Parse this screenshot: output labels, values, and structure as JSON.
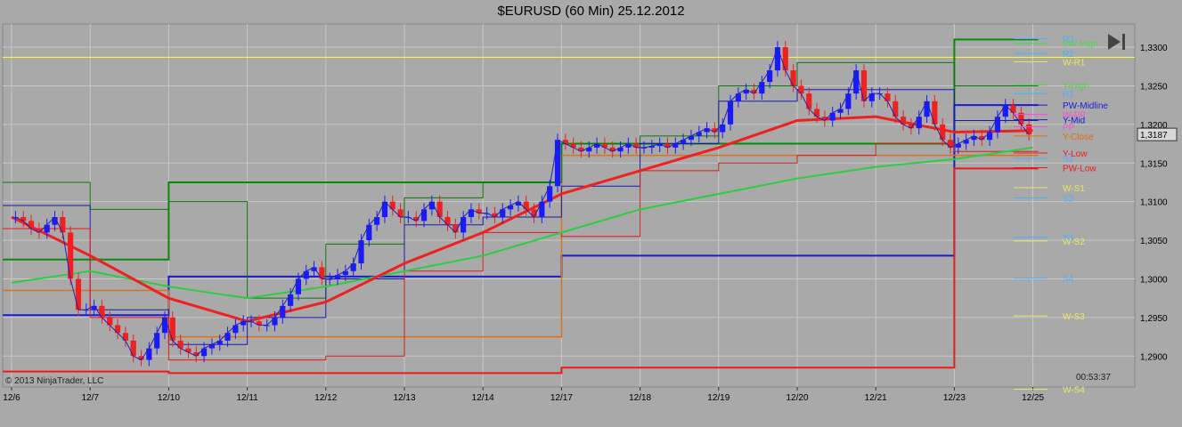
{
  "chart_data": {
    "type": "candlestick",
    "title": "$EURUSD (60 Min)  25.12.2012",
    "copyright": "© 2013 NinjaTrader, LLC",
    "timer": "00:53:37",
    "last_price": "1,3187",
    "grid": true,
    "ylim": [
      1.286,
      1.333
    ],
    "y_ticks": [
      {
        "v": 1.33,
        "label": "1,3300"
      },
      {
        "v": 1.325,
        "label": "1,3250"
      },
      {
        "v": 1.32,
        "label": "1,3200"
      },
      {
        "v": 1.315,
        "label": "1,3150"
      },
      {
        "v": 1.31,
        "label": "1,3100"
      },
      {
        "v": 1.305,
        "label": "1,3050"
      },
      {
        "v": 1.3,
        "label": "1,3000"
      },
      {
        "v": 1.295,
        "label": "1,2950"
      },
      {
        "v": 1.29,
        "label": "1,2900"
      }
    ],
    "x_ticks": [
      {
        "i": 0,
        "label": "12/6"
      },
      {
        "i": 1,
        "label": "12/7"
      },
      {
        "i": 2,
        "label": "12/10"
      },
      {
        "i": 3,
        "label": "12/11"
      },
      {
        "i": 4,
        "label": "12/12"
      },
      {
        "i": 5,
        "label": "12/13"
      },
      {
        "i": 6,
        "label": "12/14"
      },
      {
        "i": 7,
        "label": "12/17"
      },
      {
        "i": 8,
        "label": "12/18"
      },
      {
        "i": 9,
        "label": "12/19"
      },
      {
        "i": 10,
        "label": "12/20"
      },
      {
        "i": 11,
        "label": "12/21"
      },
      {
        "i": 12,
        "label": "12/23"
      },
      {
        "i": 13,
        "label": "12/25"
      }
    ],
    "horizontal_line": {
      "v": 1.3287,
      "color": "#ffff40"
    },
    "closes": [
      [
        1.308,
        1.3075,
        1.3065,
        1.306,
        1.307,
        1.308,
        1.306,
        1.3,
        1.296,
        1.296
      ],
      [
        1.2965,
        1.295,
        1.294,
        1.293,
        1.292,
        1.29,
        1.2895,
        1.291,
        1.293,
        1.295
      ],
      [
        1.292,
        1.291,
        1.2905,
        1.29,
        1.291,
        1.2915,
        1.292,
        1.293,
        1.294,
        1.2945
      ],
      [
        1.2945,
        1.294,
        1.294,
        1.295,
        1.2965,
        1.298,
        1.3,
        1.301,
        1.3015,
        1.3
      ],
      [
        1.3,
        1.3005,
        1.301,
        1.302,
        1.305,
        1.307,
        1.308,
        1.31,
        1.309,
        1.308
      ],
      [
        1.308,
        1.3075,
        1.309,
        1.31,
        1.308,
        1.307,
        1.306,
        1.308,
        1.309,
        1.3085
      ],
      [
        1.3085,
        1.308,
        1.309,
        1.3095,
        1.31,
        1.309,
        1.308,
        1.31,
        1.312,
        1.318
      ],
      [
        1.3175,
        1.317,
        1.3165,
        1.317,
        1.3175,
        1.317,
        1.3165,
        1.317,
        1.3175,
        1.317
      ],
      [
        1.317,
        1.3172,
        1.3175,
        1.317,
        1.3175,
        1.318,
        1.3185,
        1.319,
        1.3195,
        1.319
      ],
      [
        1.32,
        1.323,
        1.324,
        1.3245,
        1.324,
        1.3255,
        1.327,
        1.33,
        1.327,
        1.325
      ],
      [
        1.324,
        1.322,
        1.321,
        1.3205,
        1.3215,
        1.322,
        1.324,
        1.327,
        1.323,
        1.324
      ],
      [
        1.324,
        1.323,
        1.321,
        1.32,
        1.3195,
        1.321,
        1.323,
        1.32,
        1.318,
        1.317
      ],
      [
        1.3175,
        1.318,
        1.3185,
        1.318,
        1.319,
        1.321,
        1.3225,
        1.3215,
        1.32,
        1.3187
      ]
    ],
    "series": [
      {
        "color": "#2ecc40",
        "values": [
          1.2995,
          1.301,
          1.299,
          1.2975,
          1.299,
          1.301,
          1.303,
          1.306,
          1.309,
          1.311,
          1.313,
          1.3145,
          1.3155,
          1.317
        ]
      },
      {
        "color": "#ee2020",
        "values": [
          1.308,
          1.303,
          1.2975,
          1.2945,
          1.297,
          1.302,
          1.306,
          1.311,
          1.314,
          1.317,
          1.3205,
          1.321,
          1.319,
          1.3192
        ]
      }
    ],
    "steps": [
      {
        "color": "#0a8a0a",
        "w": 2,
        "v": [
          1.3025,
          1.3025,
          1.3125,
          1.3125,
          1.3125,
          1.3125,
          1.3125,
          1.3175,
          1.3175,
          1.3175,
          1.3175,
          1.3175,
          1.331,
          1.331
        ]
      },
      {
        "color": "#1a1adc",
        "w": 2,
        "v": [
          1.2953,
          1.2953,
          1.3003,
          1.3003,
          1.3003,
          1.3003,
          1.3003,
          1.303,
          1.303,
          1.303,
          1.303,
          1.303,
          1.3225,
          1.3225
        ]
      },
      {
        "color": "#ee1a1a",
        "w": 2,
        "v": [
          1.288,
          1.288,
          1.2878,
          1.2878,
          1.2878,
          1.2878,
          1.2878,
          1.2885,
          1.2885,
          1.2885,
          1.2885,
          1.2885,
          1.3143,
          1.3143
        ]
      },
      {
        "color": "#e07010",
        "w": 1.5,
        "v": [
          1.2985,
          1.2985,
          1.2925,
          1.2925,
          1.2925,
          1.2925,
          1.2925,
          1.316,
          1.316,
          1.316,
          1.316,
          1.316,
          1.316,
          1.316
        ]
      },
      {
        "color": "#0a7a0a",
        "w": 1,
        "v": [
          1.3125,
          1.309,
          1.31,
          1.2975,
          1.3045,
          1.3105,
          1.3125,
          1.3175,
          1.3185,
          1.325,
          1.328,
          1.328,
          1.325,
          1.325
        ]
      },
      {
        "color": "#1a1ab0",
        "w": 1,
        "v": [
          1.3095,
          1.296,
          1.2915,
          1.295,
          1.3,
          1.307,
          1.308,
          1.312,
          1.3175,
          1.323,
          1.3245,
          1.3245,
          1.3205,
          1.3205
        ]
      },
      {
        "color": "#e01a1a",
        "w": 1,
        "v": [
          1.3065,
          1.295,
          1.2895,
          1.2895,
          1.29,
          1.301,
          1.306,
          1.3055,
          1.314,
          1.315,
          1.316,
          1.3175,
          1.3165,
          1.3165
        ]
      }
    ],
    "level_labels": [
      {
        "text": "R3",
        "v": 1.3311,
        "color": "#4ab0ff"
      },
      {
        "text": "PW-High",
        "v": 1.3305,
        "color": "#4ad84a"
      },
      {
        "text": "R2",
        "v": 1.3292,
        "color": "#4ab0ff"
      },
      {
        "text": "W-R1",
        "v": 1.3281,
        "color": "#e8e860"
      },
      {
        "text": "Y-High",
        "v": 1.3251,
        "color": "#4ad84a"
      },
      {
        "text": "R1",
        "v": 1.324,
        "color": "#4ab0ff"
      },
      {
        "text": "PW-Midline",
        "v": 1.3225,
        "color": "#1a1adc"
      },
      {
        "text": "W-PP",
        "v": 1.3213,
        "color": "#ff4ad8"
      },
      {
        "text": "Y-Mid",
        "v": 1.3206,
        "color": "#1a1adc"
      },
      {
        "text": "PP",
        "v": 1.3197,
        "color": "#ff4ad8"
      },
      {
        "text": "Y-Close",
        "v": 1.3185,
        "color": "#e07010"
      },
      {
        "text": "Y-Low",
        "v": 1.3163,
        "color": "#ee1a1a"
      },
      {
        "text": "S1",
        "v": 1.3156,
        "color": "#4ab0ff"
      },
      {
        "text": "PW-Low",
        "v": 1.3144,
        "color": "#ee1a1a"
      },
      {
        "text": "W-S1",
        "v": 1.3118,
        "color": "#e8e860"
      },
      {
        "text": "S2",
        "v": 1.3105,
        "color": "#4ab0ff"
      },
      {
        "text": "S3",
        "v": 1.3054,
        "color": "#4ab0ff"
      },
      {
        "text": "W-S2",
        "v": 1.3049,
        "color": "#e8e860"
      },
      {
        "text": "S4",
        "v": 1.3001,
        "color": "#4ab0ff"
      },
      {
        "text": "W-S3",
        "v": 1.2952,
        "color": "#e8e860"
      },
      {
        "text": "W-S4",
        "v": 1.2857,
        "color": "#e8e860"
      }
    ],
    "colors": {
      "up": "#1a1aff",
      "down": "#ee2020",
      "background": "#a9a9a9",
      "grid": "#c8c8c8"
    }
  }
}
